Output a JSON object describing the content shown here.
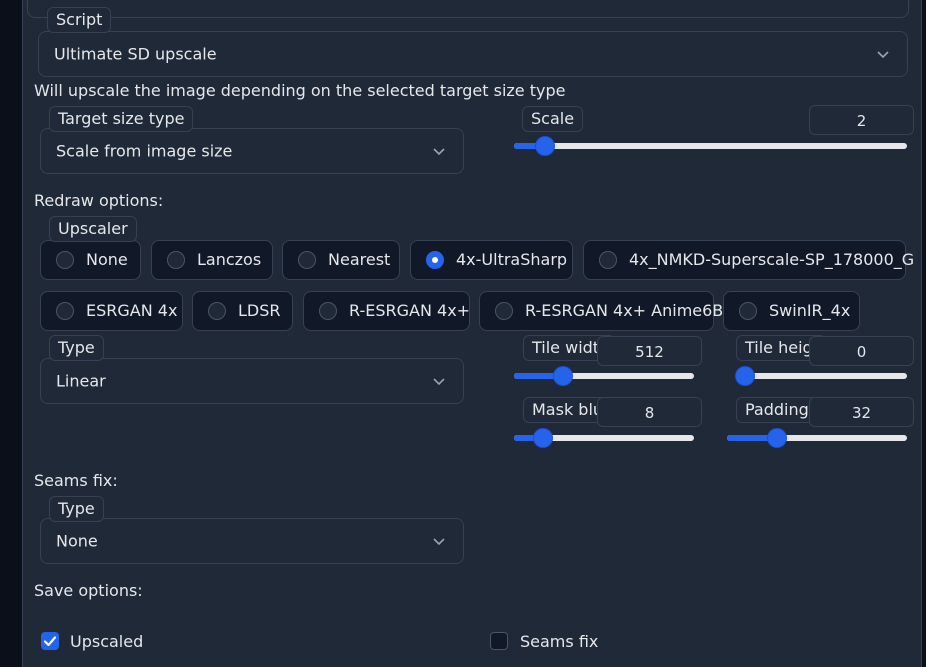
{
  "script": {
    "label": "Script",
    "value": "Ultimate SD upscale"
  },
  "description": "Will upscale the image depending on the selected target size type",
  "target_size": {
    "label": "Target size type",
    "value": "Scale from image size"
  },
  "scale": {
    "label": "Scale",
    "value": "2",
    "fraction": 0.08
  },
  "redraw": {
    "heading": "Redraw options:",
    "upscaler_label": "Upscaler",
    "upscalers": [
      {
        "label": "None",
        "selected": false
      },
      {
        "label": "Lanczos",
        "selected": false
      },
      {
        "label": "Nearest",
        "selected": false
      },
      {
        "label": "4x-UltraSharp",
        "selected": true
      },
      {
        "label": "4x_NMKD-Superscale-SP_178000_G",
        "selected": false
      },
      {
        "label": "ESRGAN 4x",
        "selected": false
      },
      {
        "label": "LDSR",
        "selected": false
      },
      {
        "label": "R-ESRGAN 4x+",
        "selected": false
      },
      {
        "label": "R-ESRGAN 4x+ Anime6B",
        "selected": false
      },
      {
        "label": "SwinIR_4x",
        "selected": false
      }
    ],
    "type_label": "Type",
    "type_value": "Linear",
    "tile_width": {
      "label": "Tile width",
      "value": "512",
      "fraction": 0.27
    },
    "tile_height": {
      "label": "Tile height",
      "value": "0",
      "fraction": 0.0
    },
    "mask_blur": {
      "label": "Mask blur",
      "value": "8",
      "fraction": 0.16
    },
    "padding": {
      "label": "Padding",
      "value": "32",
      "fraction": 0.28
    }
  },
  "seams": {
    "heading": "Seams fix:",
    "type_label": "Type",
    "type_value": "None"
  },
  "save": {
    "heading": "Save options:",
    "upscaled": {
      "label": "Upscaled",
      "checked": true
    },
    "seams_fix": {
      "label": "Seams fix",
      "checked": false
    }
  },
  "colors": {
    "accent": "#2563eb",
    "panel": "#1f2937",
    "border": "#374151"
  }
}
